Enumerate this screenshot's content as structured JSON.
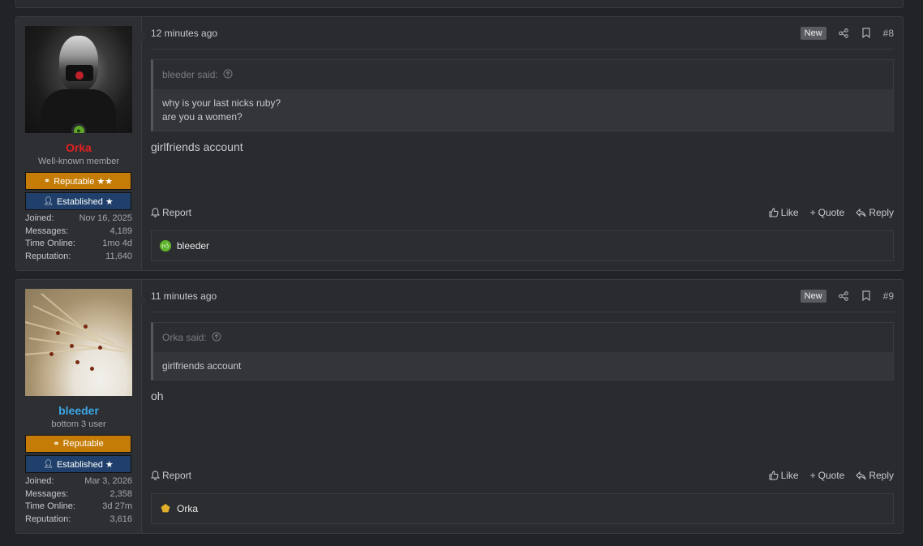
{
  "posts": [
    {
      "user": {
        "name": "Orka",
        "title": "Well-known member",
        "banner1": "Reputable ★★",
        "banner2": "Established ★",
        "stats": [
          {
            "k": "Joined:",
            "v": "Nov 16, 2025"
          },
          {
            "k": "Messages:",
            "v": "4,189"
          },
          {
            "k": "Time Online:",
            "v": "1mo 4d"
          },
          {
            "k": "Reputation:",
            "v": "11,640"
          }
        ]
      },
      "time": "12 minutes ago",
      "new_label": "New",
      "number": "#8",
      "quote": {
        "author": "bleeder said:",
        "lines": [
          "why is your last nicks ruby?",
          "are you a women?"
        ]
      },
      "message": "girlfriends account",
      "actions": {
        "report": "Report",
        "like": "Like",
        "quote": "Quote",
        "reply": "Reply"
      },
      "reaction_user": "bleeder"
    },
    {
      "user": {
        "name": "bleeder",
        "title": "bottom 3 user",
        "banner1": "Reputable",
        "banner2": "Established ★",
        "stats": [
          {
            "k": "Joined:",
            "v": "Mar 3, 2026"
          },
          {
            "k": "Messages:",
            "v": "2,358"
          },
          {
            "k": "Time Online:",
            "v": "3d 27m"
          },
          {
            "k": "Reputation:",
            "v": "3,616"
          }
        ]
      },
      "time": "11 minutes ago",
      "new_label": "New",
      "number": "#9",
      "quote": {
        "author": "Orka said:",
        "lines": [
          "girlfriends account"
        ]
      },
      "message": "oh",
      "actions": {
        "report": "Report",
        "like": "Like",
        "quote": "Quote",
        "reply": "Reply"
      },
      "reaction_user": "Orka"
    }
  ]
}
